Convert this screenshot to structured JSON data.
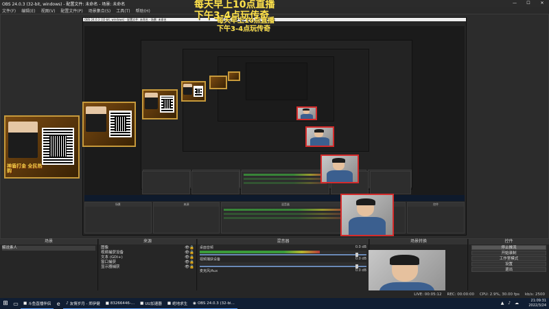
{
  "window": {
    "title": "OBS 24.0.3 (32-bit, windows) - 配置文件: 未命名 - 场景: 未命名",
    "controls": [
      "—",
      "☐",
      "✕"
    ]
  },
  "menu": [
    "文件(F)",
    "编辑(E)",
    "视图(V)",
    "配置文件(P)",
    "场景集合(S)",
    "工具(T)",
    "帮助(H)"
  ],
  "overlay": {
    "line1": "每天早上10点直播",
    "line2": "下午3-4点玩传奇"
  },
  "promo": {
    "text": "神盾打金 全民热购"
  },
  "nested_panels": [
    "场景",
    "来源",
    "混音器",
    "场景转换",
    "控件"
  ],
  "docks": {
    "scenes": {
      "title": "场景",
      "items": [
        "解说素人"
      ]
    },
    "sources": {
      "title": "来源",
      "items": [
        "图像",
        "视频捕获设备",
        "文本 (GDI+)",
        "窗口捕获",
        "显示器捕获"
      ]
    },
    "mixer": {
      "title": "混音器",
      "tracks": [
        {
          "name": "桌面音频",
          "db": "0.0 dB",
          "level": 0.72
        },
        {
          "name": "视频捕获设备",
          "db": "0.0 dB",
          "level": 0.0
        },
        {
          "name": "麦克风/Aux",
          "db": "0.0 dB",
          "level": 0.0
        }
      ]
    },
    "transitions": {
      "title": "场景转换"
    },
    "controls": {
      "title": "控件",
      "buttons": [
        "停止推流",
        "开始录制",
        "工作室模式",
        "设置",
        "退出"
      ]
    }
  },
  "status": {
    "cpu": "CPU: 2.9%, 30.00 fps",
    "rec": "REC: 00:00:00",
    "live": "LIVE: 00:05:12",
    "kbps": "kb/s: 2500"
  },
  "taskbar": {
    "apps": [
      "斗鱼直播伴侣",
      "友情岁月 - 郑伊健",
      "83266446-...",
      "UU加速器",
      "绝地求生",
      "OBS 24.0.3 (32-bi..."
    ],
    "time": "21:09:31",
    "date": "2022/3/24"
  },
  "colors": {
    "accent": "#ffe24a",
    "cam_border": "#d52b2b",
    "meter_green": "#3a9b3a",
    "taskbar": "#101e33"
  }
}
